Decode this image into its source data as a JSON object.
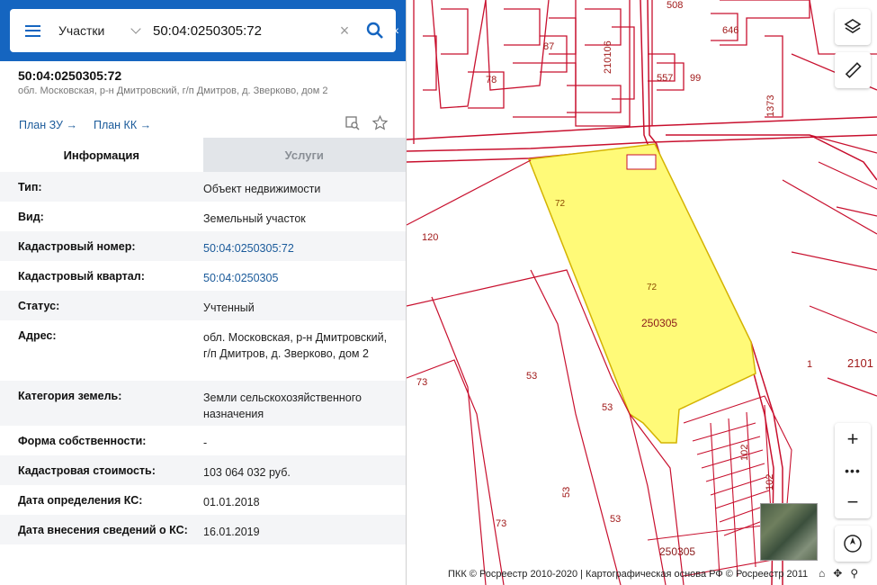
{
  "search": {
    "type_label": "Участки",
    "query": "50:04:0250305:72"
  },
  "object": {
    "title": "50:04:0250305:72",
    "subtitle": "обл. Московская, р-н Дмитровский, г/п Дмитров, д. Зверково, дом 2",
    "plan_zu": "План ЗУ",
    "plan_kk": "План КК"
  },
  "tabs": {
    "info": "Информация",
    "services": "Услуги"
  },
  "info": {
    "rows": [
      {
        "key": "Тип:",
        "value": "Объект недвижимости"
      },
      {
        "key": "Вид:",
        "value": "Земельный участок"
      },
      {
        "key": "Кадастровый номер:",
        "value": "50:04:0250305:72"
      },
      {
        "key": "Кадастровый квартал:",
        "value": "50:04:0250305"
      },
      {
        "key": "Статус:",
        "value": "Учтенный"
      },
      {
        "key": "Адрес:",
        "value": "обл. Московская, р-н Дмитровский, г/п Дмитров, д. Зверково, дом 2"
      },
      {
        "key": "Категория земель:",
        "value": "Земли сельскохозяйственного назначения"
      },
      {
        "key": "Форма собственности:",
        "value": "-"
      },
      {
        "key": "Кадастровая стоимость:",
        "value": "103 064 032 руб."
      },
      {
        "key": "Дата определения КС:",
        "value": "01.01.2018"
      },
      {
        "key": "Дата внесения сведений о КС:",
        "value": "16.01.2019"
      }
    ]
  },
  "map": {
    "labels": {
      "l508": "508",
      "l646": "646",
      "l87": "87",
      "l78": "78",
      "l557": "557",
      "l99": "99",
      "l1373": "1373",
      "l210106": "210106",
      "l120": "120",
      "l72a": "72",
      "l72b": "72",
      "l250305": "250305",
      "l73a": "73",
      "l53a": "53",
      "l53b": "53",
      "l53c": "53",
      "l73b": "73",
      "l53d": "53",
      "l1": "1",
      "l2101": "2101",
      "l102a": "102",
      "l102b": "102",
      "l250305b": "250305"
    },
    "parcel_color": "#fffa78",
    "line_color": "#c8102e",
    "copyright": "ПКК © Росреестр 2010-2020 | Картографическая основа РФ © Росреестр 2011"
  }
}
